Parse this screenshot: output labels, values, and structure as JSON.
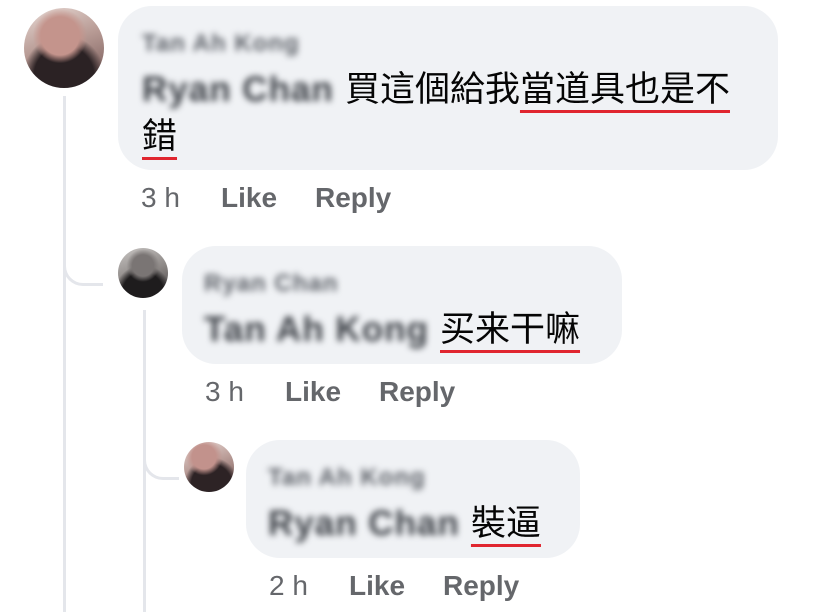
{
  "thread": {
    "comments": [
      {
        "author": "Tan Ah Kong",
        "mention": "Ryan Chan",
        "text": "買這個給我",
        "underlined_text": "當道具也是不錯",
        "time": "3 h",
        "like_label": "Like",
        "reply_label": "Reply"
      },
      {
        "author": "Ryan Chan",
        "mention": "Tan Ah Kong",
        "text": "",
        "underlined_text": "买来干嘛",
        "time": "3 h",
        "like_label": "Like",
        "reply_label": "Reply"
      },
      {
        "author": "Tan Ah Kong",
        "mention": "Ryan Chan",
        "text": "",
        "underlined_text": "裝逼",
        "time": "2 h",
        "like_label": "Like",
        "reply_label": "Reply"
      }
    ]
  },
  "colors": {
    "bubble": "#f0f2f5",
    "meta_text": "#65676b",
    "underline": "#e0262f",
    "thread_line": "#e4e6eb"
  }
}
